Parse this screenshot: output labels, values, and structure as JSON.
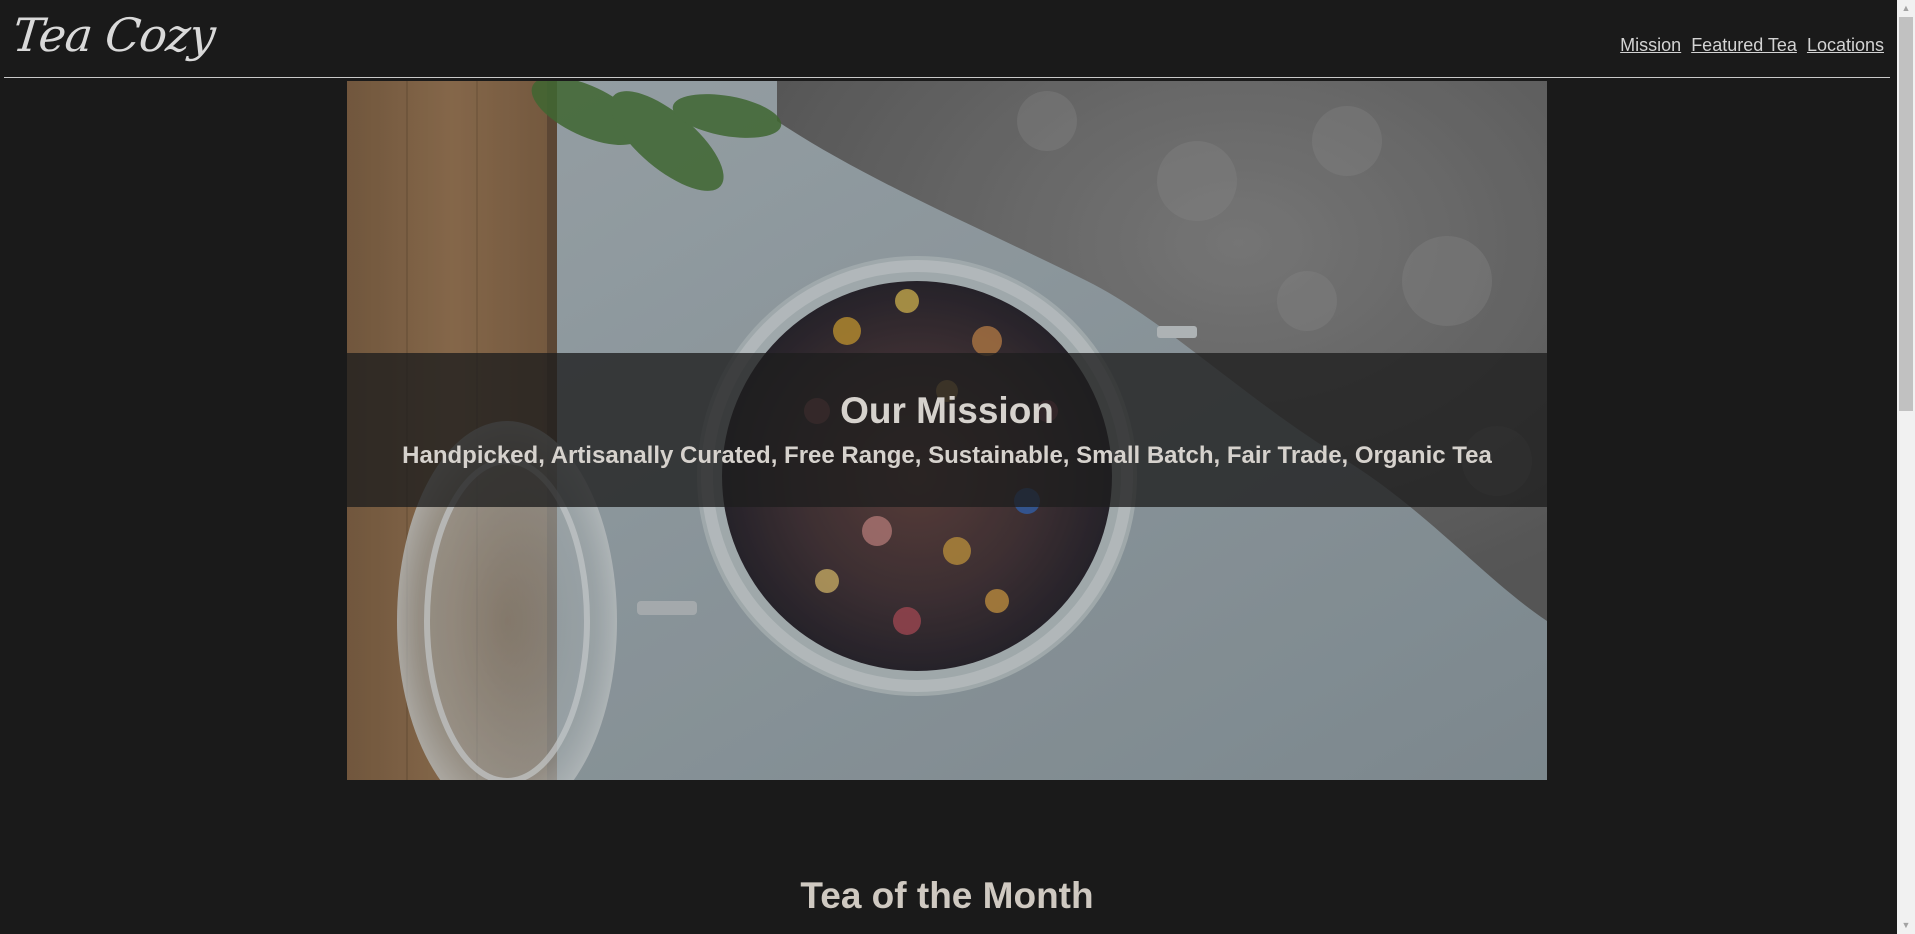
{
  "header": {
    "logo": "Tea Cozy",
    "nav": [
      {
        "label": "Mission"
      },
      {
        "label": "Featured Tea"
      },
      {
        "label": "Locations"
      }
    ]
  },
  "hero": {
    "title": "Our Mission",
    "text": "Handpicked, Artisanally Curated, Free Range, Sustainable, Small Batch, Fair Trade, Organic Tea"
  },
  "tea_of_month": {
    "heading": "Tea of the Month"
  },
  "icons": {
    "scroll_up": "triangle-up-icon",
    "scroll_down": "triangle-down-icon"
  },
  "colors": {
    "background": "#1a1a1a",
    "text": "#d6d2cd",
    "band": "#1e1e1e"
  }
}
